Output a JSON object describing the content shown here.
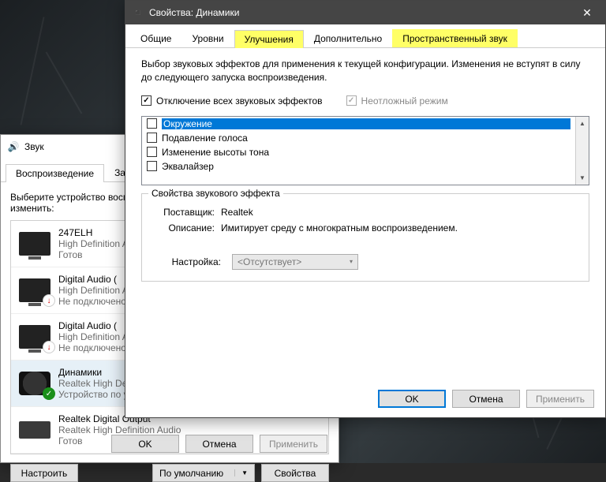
{
  "sound_window": {
    "title": "Звук",
    "tabs": {
      "playback": "Воспроизведение",
      "record": "Запись"
    },
    "instruction": "Выберите устройство воспроизведения, параметры которого нужно изменить:",
    "devices": [
      {
        "name": "247ELH",
        "sub": "High Definition Audio",
        "status": "Готов",
        "icon": "tv",
        "badge": ""
      },
      {
        "name": "Digital Audio (",
        "sub": "High Definition Audio",
        "status": "Не подключено",
        "icon": "tv",
        "badge": "err"
      },
      {
        "name": "Digital Audio (",
        "sub": "High Definition Audio",
        "status": "Не подключено",
        "icon": "tv",
        "badge": "err"
      },
      {
        "name": "Динамики",
        "sub": "Realtek High Definition Audio",
        "status": "Устройство по умолчанию",
        "icon": "speaker",
        "badge": "ok",
        "selected": true
      },
      {
        "name": "Realtek Digital Output",
        "sub": "Realtek High Definition Audio",
        "status": "Готов",
        "icon": "box",
        "badge": ""
      }
    ],
    "buttons": {
      "configure": "Настроить",
      "default": "По умолчанию",
      "properties": "Свойства",
      "ok": "OK",
      "cancel": "Отмена",
      "apply": "Применить"
    }
  },
  "props_window": {
    "title": "Свойства: Динамики",
    "tabs": {
      "general": "Общие",
      "levels": "Уровни",
      "enhance": "Улучшения",
      "advanced": "Дополнительно",
      "spatial": "Пространственный звук"
    },
    "description": "Выбор звуковых эффектов для применения к текущей конфигурации. Изменения не вступят в силу до следующего запуска воспроизведения.",
    "checkboxes": {
      "disable_all": "Отключение всех звуковых эффектов",
      "urgent": "Неотложный режим"
    },
    "effects": [
      {
        "label": "Окружение",
        "selected": true
      },
      {
        "label": "Подавление голоса"
      },
      {
        "label": "Изменение высоты тона"
      },
      {
        "label": "Эквалайзер"
      }
    ],
    "group": {
      "legend": "Свойства звукового эффекта",
      "provider_k": "Поставщик:",
      "provider_v": "Realtek",
      "desc_k": "Описание:",
      "desc_v": "Имитирует среду с многократным воспроизведением.",
      "setting_k": "Настройка:",
      "setting_v": "<Отсутствует>"
    },
    "buttons": {
      "ok": "OK",
      "cancel": "Отмена",
      "apply": "Применить"
    }
  }
}
